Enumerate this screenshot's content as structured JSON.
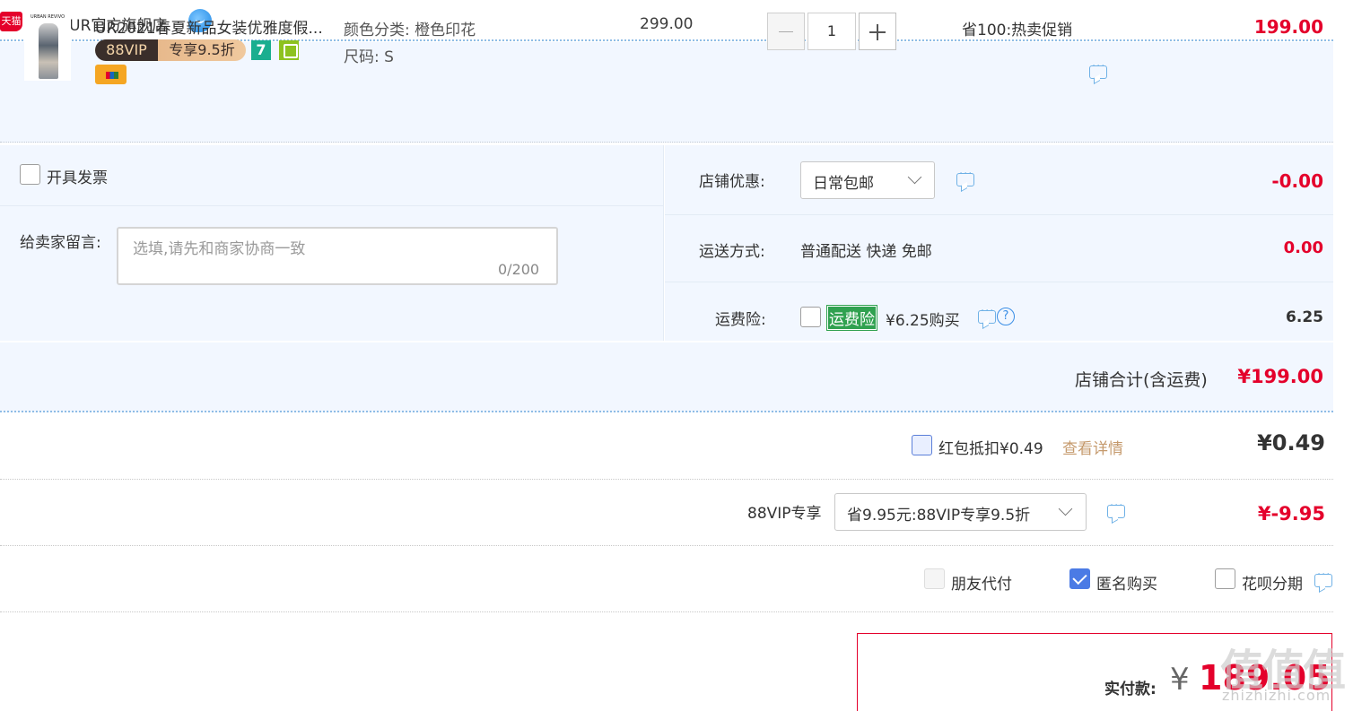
{
  "shop": {
    "badge": "天猫",
    "label": "店铺: UR官方旗舰店"
  },
  "item": {
    "brand": "URBAN REVIVO",
    "title": "UR2021春夏新品女装优雅度假...",
    "vip_left": "88VIP",
    "vip_right": "专享9.5折",
    "seven_badge": "7",
    "sku_color": "颜色分类: 橙色印花",
    "sku_size": "尺码: S",
    "original_price": "299.00",
    "quantity": "1",
    "promotion": "省100:热卖促销",
    "price": "199.00"
  },
  "invoice": {
    "label": "开具发票"
  },
  "message": {
    "label": "给卖家留言:",
    "placeholder": "选填,请先和商家协商一致",
    "count": "0/200"
  },
  "shop_discount": {
    "label": "店铺优惠:",
    "selected": "日常包邮",
    "value": "-0.00"
  },
  "shipping": {
    "label": "运送方式:",
    "method": "普通配送 快递 免邮",
    "value": "0.00"
  },
  "insurance": {
    "label": "运费险:",
    "tag": "运费险",
    "price": "¥6.25购买",
    "help": "?",
    "value": "6.25"
  },
  "shop_total": {
    "label": "店铺合计(含运费)",
    "value": "¥199.00"
  },
  "red_packet": {
    "label": "红包抵扣¥0.49",
    "link": "查看详情",
    "value": "¥0.49"
  },
  "vip_discount": {
    "label": "88VIP专享",
    "selected": "省9.95元:88VIP专享9.5折",
    "value": "¥-9.95"
  },
  "options": {
    "friend_pay": "朋友代付",
    "anonymous": "匿名购买",
    "huabei": "花呗分期"
  },
  "payment": {
    "label": "实付款:",
    "currency": "¥",
    "amount": "189.05"
  },
  "watermark": {
    "glyphs": "值值值",
    "text": "zhizhizhi.com"
  },
  "colors": {
    "accent_red": "#e4002b",
    "panel_bg": "#f2f7ff",
    "link_blue": "#6fb1e6",
    "tag_green": "#30a150"
  }
}
